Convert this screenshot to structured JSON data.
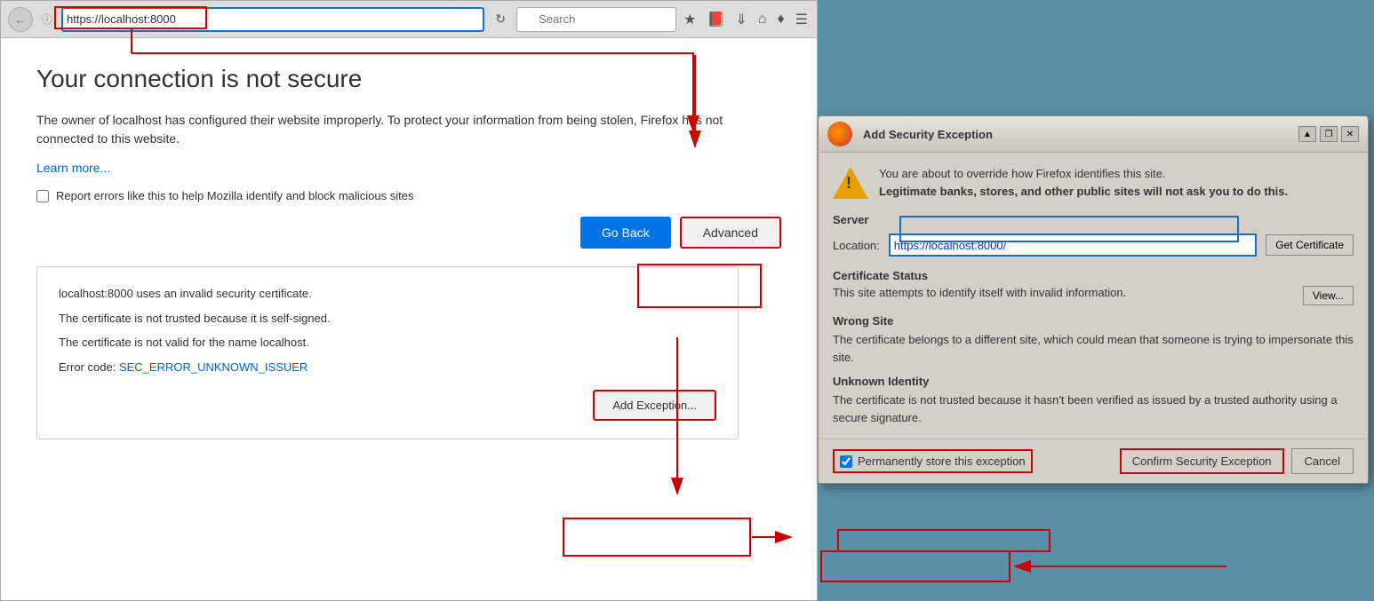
{
  "browser": {
    "url": "https://localhost:8000",
    "search_placeholder": "Search",
    "toolbar_icons": [
      "star",
      "bookmark",
      "download",
      "home",
      "shield",
      "menu"
    ]
  },
  "error_page": {
    "title": "Your connection is not secure",
    "description": "The owner of localhost has configured their website improperly. To protect your information from being stolen, Firefox has not connected to this website.",
    "learn_more": "Learn more...",
    "checkbox_label": "Report errors like this to help Mozilla identify and block malicious sites",
    "btn_go_back": "Go Back",
    "btn_advanced": "Advanced",
    "advanced_line1": "localhost:8000 uses an invalid security certificate.",
    "advanced_line2": "The certificate is not trusted because it is self-signed.",
    "advanced_line3": "The certificate is not valid for the name localhost.",
    "error_code_label": "Error code:",
    "error_code": "SEC_ERROR_UNKNOWN_ISSUER",
    "btn_add_exception": "Add Exception..."
  },
  "dialog": {
    "title": "Add Security Exception",
    "warning_text1": "You are about to override how Firefox identifies this site.",
    "warning_text2": "Legitimate banks, stores, and other public sites will not ask you to do this.",
    "server_section": "Server",
    "location_label": "Location:",
    "location_value": "https://localhost:8000/",
    "btn_get_cert": "Get Certificate",
    "cert_status_title": "Certificate Status",
    "cert_status_text": "This site attempts to identify itself with invalid information.",
    "btn_view": "View...",
    "wrong_site_title": "Wrong Site",
    "wrong_site_text": "The certificate belongs to a different site, which could mean that someone is trying to impersonate this site.",
    "unknown_identity_title": "Unknown Identity",
    "unknown_identity_text": "The certificate is not trusted because it hasn't been verified as issued by a trusted authority using a secure signature.",
    "permanently_store_label": "Permanently store this exception",
    "btn_confirm": "Confirm Security Exception",
    "btn_cancel": "Cancel",
    "titlebar_btn_up": "▲",
    "titlebar_btn_restore": "❐",
    "titlebar_btn_close": "✕"
  }
}
